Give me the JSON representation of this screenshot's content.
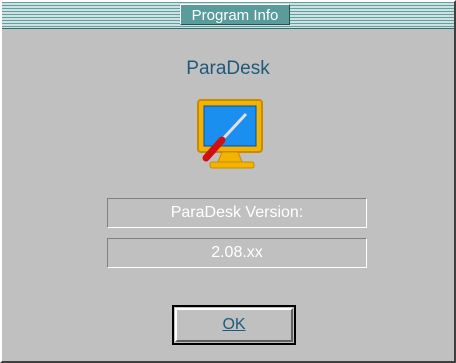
{
  "window": {
    "title": "Program Info"
  },
  "app": {
    "name": "ParaDesk",
    "icon": "monitor-screwdriver-icon"
  },
  "version": {
    "label": "ParaDesk Version:",
    "value": "2.08.xx"
  },
  "buttons": {
    "ok_label": "OK"
  },
  "colors": {
    "titlebar": "#5a9c9c",
    "text_accent": "#1f5a7a",
    "background": "#c0c0c0"
  }
}
